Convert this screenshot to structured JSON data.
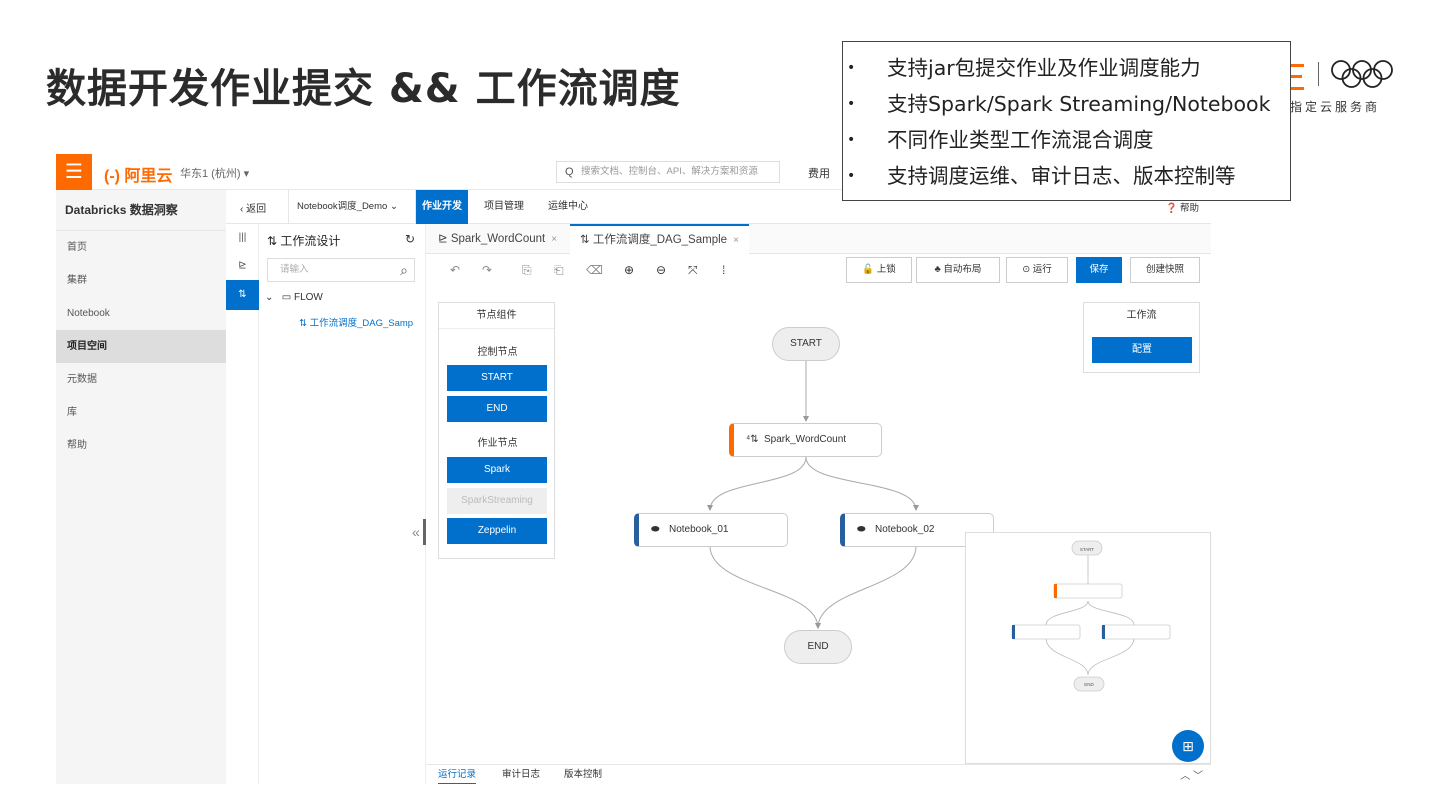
{
  "slide": {
    "title": "数据开发作业提交 && 工作流调度",
    "features": [
      "支持jar包提交作业及作业调度能力",
      "支持Spark/Spark Streaming/Notebook",
      "不同作业类型工作流混合调度",
      "支持调度运维、审计日志、版本控制等"
    ],
    "bullet": "•",
    "brand_tag": "指定云服务商"
  },
  "topbar": {
    "menu_icon": "☰",
    "logo": "(-) 阿里云",
    "region": "华东1 (杭州)",
    "region_caret": "▾",
    "search_placeholder": "搜索文档、控制台、API、解决方案和资源",
    "search_icon": "Q",
    "fee": "费用"
  },
  "sidebar": {
    "title": "Databricks 数据洞察",
    "items": [
      "首页",
      "集群",
      "Notebook",
      "项目空间",
      "元数据",
      "库",
      "帮助"
    ],
    "collapse_icon": "‹"
  },
  "subbar": {
    "back": "返回",
    "back_icon": "‹",
    "project": "Notebook调度_Demo",
    "project_caret": "⌄",
    "nav": [
      "作业开发",
      "项目管理",
      "运维中心"
    ],
    "help": "帮助",
    "help_icon": "❓"
  },
  "iconcol": {
    "icons": [
      "|||",
      "⊵",
      "⇅"
    ]
  },
  "tree": {
    "title": "工作流设计",
    "title_icon": "⇅",
    "refresh_icon": "↻",
    "search_placeholder": "请输入",
    "search_icon": "⌕",
    "root": "FLOW",
    "root_caret": "⌄",
    "root_icon": "▭",
    "leaf": "工作流调度_DAG_Samp",
    "leaf_icon": "⇅",
    "collapse_icon": "«"
  },
  "tabs": [
    {
      "icon": "⊵",
      "label": "Spark_WordCount",
      "close": "×"
    },
    {
      "icon": "⇅",
      "label": "工作流调度_DAG_Sample",
      "close": "×"
    }
  ],
  "toolbar": {
    "icons": [
      "↶",
      "↷",
      "⎘",
      "⎗",
      "⌫",
      "⊕",
      "⊖",
      "⤧",
      "⁞"
    ],
    "buttons": [
      {
        "icon": "🔓",
        "label": "上锁"
      },
      {
        "icon": "♣",
        "label": "自动布局"
      },
      {
        "icon": "⊙",
        "label": "运行"
      },
      {
        "icon": "",
        "label": "保存"
      },
      {
        "icon": "",
        "label": "创建快照"
      }
    ]
  },
  "palette": {
    "title": "节点组件",
    "control_group": "控制节点",
    "control_nodes": [
      "START",
      "END"
    ],
    "job_group": "作业节点",
    "job_nodes": [
      "Spark",
      "SparkStreaming",
      "Zeppelin"
    ]
  },
  "workflow_panel": {
    "title": "工作流",
    "config": "配置"
  },
  "dag": {
    "start": "START",
    "end": "END",
    "spark": "Spark_WordCount",
    "spark_icon": "⁴⇅",
    "nb1": "Notebook_01",
    "nb2": "Notebook_02",
    "nb_icon": "⬬"
  },
  "minimap": {
    "start": "START",
    "end": "END"
  },
  "fab": {
    "icon": "⊞"
  },
  "bottom_tabs": [
    "运行记录",
    "审计日志",
    "版本控制"
  ],
  "bottom_arrows": "︿ ﹀",
  "colors": {
    "accent": "#0070cc",
    "brand": "#ff6a00",
    "nb_bar": "#2a5f9e"
  }
}
